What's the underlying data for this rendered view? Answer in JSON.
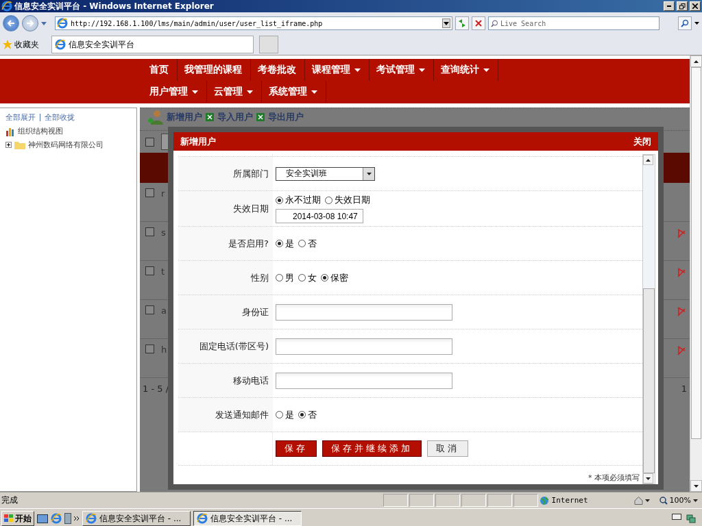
{
  "window": {
    "title": "信息安全实训平台 - Windows Internet Explorer"
  },
  "address_bar": {
    "url": "http://192.168.1.100/lms/main/admin/user/user_list_iframe.php"
  },
  "search": {
    "placeholder": "Live Search"
  },
  "favorites": {
    "label": "收藏夹"
  },
  "tabs": [
    {
      "label": "信息安全实训平台",
      "selected": true
    }
  ],
  "nav": [
    {
      "label": "首页",
      "dropdown": false
    },
    {
      "label": "我管理的课程",
      "dropdown": false
    },
    {
      "label": "考卷批改",
      "dropdown": false
    },
    {
      "label": "课程管理",
      "dropdown": true
    },
    {
      "label": "考试管理",
      "dropdown": true
    },
    {
      "label": "查询统计",
      "dropdown": true
    },
    {
      "label": "用户管理",
      "dropdown": true
    },
    {
      "label": "云管理",
      "dropdown": true
    },
    {
      "label": "系统管理",
      "dropdown": true
    }
  ],
  "sidebar": {
    "links": [
      "全部展开",
      "全部收拢"
    ],
    "tree_title": "组织结构视图",
    "tree": [
      {
        "label": "神州数码网络有限公司",
        "expanded": false
      }
    ]
  },
  "user_list": {
    "toolbar": [
      "新增用户",
      "导入用户",
      "导出用户"
    ],
    "select_all": {
      "checked": false
    },
    "rows": [
      {
        "cell": "r",
        "checked": false
      },
      {
        "cell": "s",
        "checked": false
      },
      {
        "cell": "t",
        "checked": false
      },
      {
        "cell": "a",
        "checked": false
      },
      {
        "cell": "h",
        "checked": false
      }
    ],
    "pagination": "1 - 5 /",
    "page": "1"
  },
  "dialog": {
    "title": "新增用户",
    "close": "关闭",
    "fields": [
      {
        "kind": "select",
        "label": "所属部门",
        "value": "安全实训班"
      },
      {
        "kind": "radio",
        "label": "失效日期",
        "options": [
          {
            "label": "永不过期",
            "selected": true
          },
          {
            "label": "失效日期",
            "selected": false
          }
        ],
        "value": "2014-03-08 10:47"
      },
      {
        "kind": "radio",
        "label": "是否启用?",
        "options": [
          {
            "label": "是",
            "selected": true
          },
          {
            "label": "否",
            "selected": false
          }
        ]
      },
      {
        "kind": "radio",
        "label": "性别",
        "options": [
          {
            "label": "男",
            "selected": false
          },
          {
            "label": "女",
            "selected": false
          },
          {
            "label": "保密",
            "selected": true
          }
        ]
      },
      {
        "kind": "text",
        "label": "身份证"
      },
      {
        "kind": "text",
        "label": "固定电话(带区号)"
      },
      {
        "kind": "text",
        "label": "移动电话"
      },
      {
        "kind": "radio",
        "label": "发送通知邮件",
        "options": [
          {
            "label": "是",
            "selected": false
          },
          {
            "label": "否",
            "selected": true
          }
        ]
      }
    ],
    "buttons": [
      {
        "label": "保存",
        "kind": "primary"
      },
      {
        "label": "保存并继续添加",
        "kind": "primary"
      },
      {
        "label": "取消",
        "kind": "secondary"
      }
    ],
    "note": "* 本项必须填写"
  },
  "status_bar": {
    "text": "完成",
    "zone": "Internet",
    "zoom": "100%"
  },
  "taskbar": {
    "start": "开始",
    "tasks": [
      {
        "label": "信息安全实训平台 - ...",
        "selected": false
      },
      {
        "label": "信息安全实训平台 - ...",
        "selected": true
      }
    ]
  }
}
